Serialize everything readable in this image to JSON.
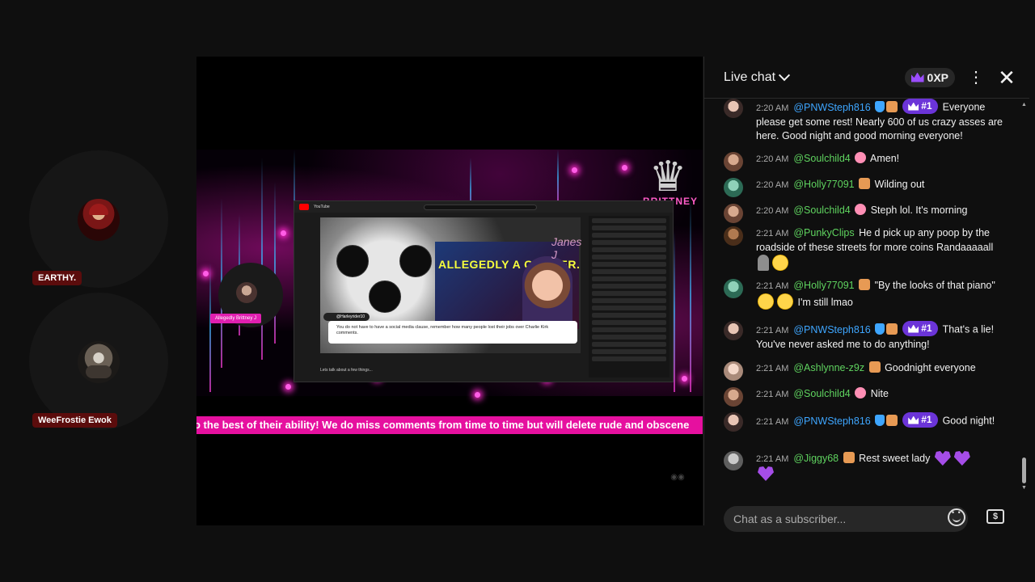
{
  "participants": [
    {
      "name": "EARTHY."
    },
    {
      "name": "WeeFrostie Ewok"
    }
  ],
  "video": {
    "ticker_text": "o the best of their ability! We do miss comments from time to time but will delete rude and obscene",
    "brand_text": "BRITTNEY J",
    "host_tag": "Allegedly Brittney J",
    "inner": {
      "site": "YouTube",
      "overlay_text": "ALLEGEDLY A GRIFTER.",
      "signature": "Janes J",
      "commenter": "@Harleyrider10",
      "comment": "You do not have to have a social media clause, remember how many people lost their jobs over Charlie Kirk comments.",
      "caption": "Lets talk about a few things..."
    }
  },
  "chat": {
    "title": "Live chat",
    "xp_label": "0XP",
    "input_placeholder": "Chat as a subscriber...",
    "messages": [
      {
        "time": "2:20 AM",
        "author": "@PNWSteph816",
        "rank": "#1",
        "text": "Everyone please get some rest! Nearly 600 of us crazy asses are here. Good night and good morning everyone!"
      },
      {
        "time": "2:20 AM",
        "author": "@Soulchild4",
        "text": "Amen!"
      },
      {
        "time": "2:20 AM",
        "author": "@Holly77091",
        "text": "Wilding out"
      },
      {
        "time": "2:20 AM",
        "author": "@Soulchild4",
        "text": "Steph lol. It's morning"
      },
      {
        "time": "2:21 AM",
        "author": "@PunkyClips",
        "text": "He d pick up any poop by the roadside of these streets for more coins Randaaaaall"
      },
      {
        "time": "2:21 AM",
        "author": "@Holly77091",
        "text_a": "\"By the looks of that piano\"",
        "text_b": "I'm still lmao"
      },
      {
        "time": "2:21 AM",
        "author": "@PNWSteph816",
        "rank": "#1",
        "text": "That's a lie! You've never asked me to do anything!"
      },
      {
        "time": "2:21 AM",
        "author": "@Ashlynne-z9z",
        "text": "Goodnight everyone"
      },
      {
        "time": "2:21 AM",
        "author": "@Soulchild4",
        "text": "Nite"
      },
      {
        "time": "2:21 AM",
        "author": "@PNWSteph816",
        "rank": "#1",
        "text": "Good night!"
      },
      {
        "time": "2:21 AM",
        "author": "@Jiggy68",
        "text": "Rest sweet lady"
      }
    ]
  },
  "colors": {
    "accent_pink": "#e6109f",
    "author_green": "#5fd35f",
    "author_blue": "#3ea6ff",
    "rank_purple": "#6b34d8"
  },
  "icons": [
    "chevron-down-icon",
    "crown-icon",
    "kebab-menu-icon",
    "close-icon",
    "verified-icon",
    "member-badge-icon",
    "emoji-icon",
    "superchat-icon"
  ]
}
